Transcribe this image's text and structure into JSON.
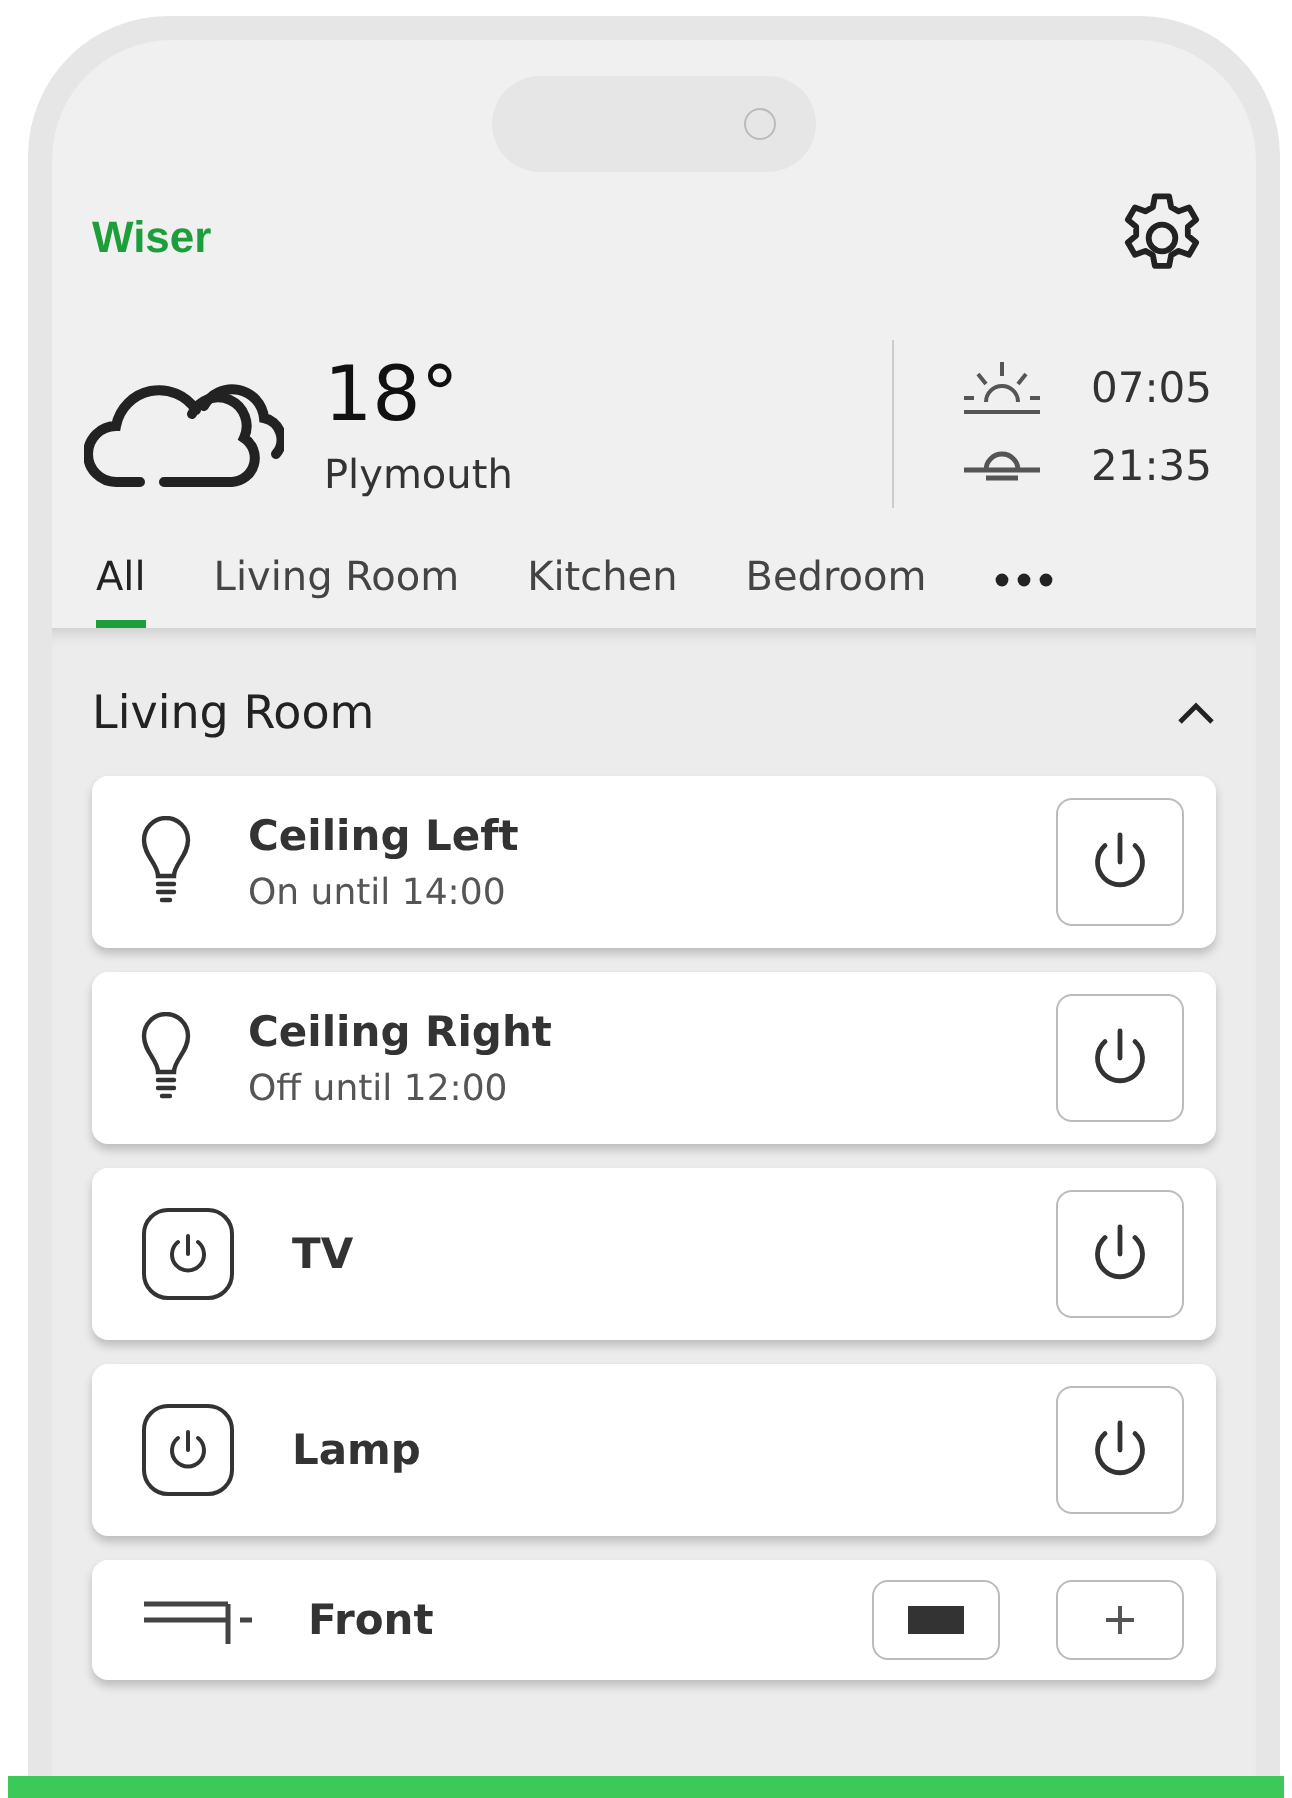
{
  "header": {
    "logo": "Wiser"
  },
  "weather": {
    "temperature": "18°",
    "city": "Plymouth",
    "sunrise": "07:05",
    "sunset": "21:35"
  },
  "tabs": [
    {
      "label": "All",
      "selected": true
    },
    {
      "label": "Living Room",
      "selected": false
    },
    {
      "label": "Kitchen",
      "selected": false
    },
    {
      "label": "Bedroom",
      "selected": false
    }
  ],
  "section": {
    "title": "Living Room",
    "expanded": true
  },
  "devices": [
    {
      "kind": "light",
      "name": "Ceiling Left",
      "status": "On until 14:00"
    },
    {
      "kind": "light",
      "name": "Ceiling Right",
      "status": "Off until 12:00"
    },
    {
      "kind": "socket",
      "name": "TV"
    },
    {
      "kind": "socket",
      "name": "Lamp"
    },
    {
      "kind": "blind",
      "name": "Front"
    }
  ]
}
